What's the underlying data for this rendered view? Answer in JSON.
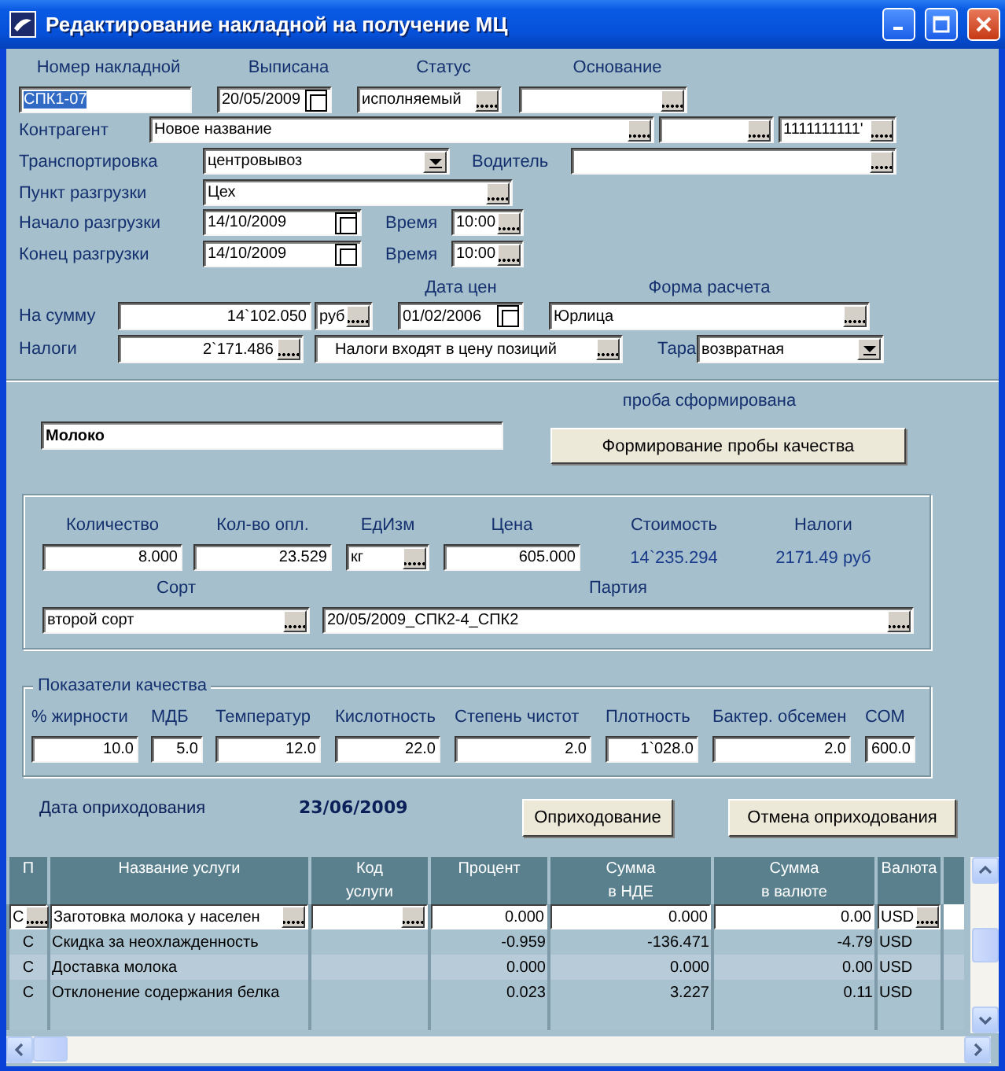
{
  "window": {
    "title": "Редактирование накладной на получение МЦ"
  },
  "header": {
    "number": {
      "label": "Номер накладной",
      "value": "СПК1-07",
      "focused": true
    },
    "issued": {
      "label": "Выписана",
      "value": "20/05/2009"
    },
    "status": {
      "label": "Статус",
      "value": "исполняемый"
    },
    "basis": {
      "label": "Основание"
    },
    "counterparty": {
      "label": "Контрагент",
      "value": "Новое название",
      "inn": "1111111111'"
    },
    "transport": {
      "label": "Транспортировка",
      "value": "центровывоз"
    },
    "driver": {
      "label": "Водитель"
    },
    "unload_point": {
      "label": "Пункт разгрузки",
      "value": "Цех"
    },
    "unload_start": {
      "label": "Начало разгрузки",
      "date": "14/10/2009",
      "time_label": "Время",
      "time": "10:00"
    },
    "unload_end": {
      "label": "Конец разгрузки",
      "date": "14/10/2009",
      "time_label": "Время",
      "time": "10:00"
    },
    "price_date": {
      "label": "Дата цен",
      "value": "01/02/2006"
    },
    "payment_form": {
      "label": "Форма расчета",
      "value": "Юрлица"
    },
    "amount": {
      "label": "На сумму",
      "value": "14`102.050",
      "currency": "руб"
    },
    "taxes": {
      "label": "Налоги",
      "value": "2`171.486",
      "mode": "Налоги входят в цену позиций"
    },
    "container": {
      "label": "Тара",
      "value": "возвратная"
    }
  },
  "product": {
    "status_note": "проба сформирована",
    "name": "Молоко",
    "quality_button": "Формирование пробы качества"
  },
  "pricing": {
    "items": [
      {
        "kind": "input",
        "label": "Количество",
        "value": "8.000"
      },
      {
        "kind": "input",
        "label": "Кол-во опл.",
        "value": "23.529"
      },
      {
        "kind": "lookup",
        "label": "ЕдИзм",
        "value": "кг"
      },
      {
        "kind": "input",
        "label": "Цена",
        "value": "605.000"
      },
      {
        "kind": "readout",
        "label": "Стоимость",
        "value": "14`235.294"
      },
      {
        "kind": "readout",
        "label": "Налоги",
        "value": "2171.49 руб"
      }
    ],
    "grade": {
      "label": "Сорт",
      "value": "второй сорт"
    },
    "batch": {
      "label": "Партия",
      "value": "20/05/2009_СПК2-4_СПК2"
    }
  },
  "quality": {
    "title": "Показатели качества",
    "indicators": [
      {
        "label": "% жирности",
        "value": "10.0"
      },
      {
        "label": "МДБ",
        "value": "5.0"
      },
      {
        "label": "Температур",
        "value": "12.0"
      },
      {
        "label": "Кислотность",
        "value": "22.0"
      },
      {
        "label": "Степень чистот",
        "value": "2.0"
      },
      {
        "label": "Плотность",
        "value": "1`028.0"
      },
      {
        "label": "Бактер. обсемен",
        "value": "2.0"
      },
      {
        "label": "СОМ",
        "value": "600.0"
      }
    ]
  },
  "posting": {
    "date_label": "Дата оприходования",
    "date": "23/06/2009",
    "buttons": [
      "Оприходование",
      "Отмена оприходования"
    ]
  },
  "services": {
    "columns": [
      "П",
      "Название услуги",
      "Код\nуслуги",
      "Процент",
      "Сумма\nв НДЕ",
      "Сумма\nв валюте",
      "Валюта"
    ],
    "rows": [
      {
        "selected": true,
        "type": "С",
        "name": "Заготовка молока у населен",
        "code": "",
        "percent": "0.000",
        "sum_base": "0.000",
        "sum_currency": "0.00",
        "currency": "USD"
      },
      {
        "selected": false,
        "type": "С",
        "name": "Скидка за неохлажденность",
        "code": "",
        "percent": "-0.959",
        "sum_base": "-136.471",
        "sum_currency": "-4.79",
        "currency": "USD"
      },
      {
        "selected": false,
        "type": "С",
        "name": "Доставка молока",
        "code": "",
        "percent": "0.000",
        "sum_base": "0.000",
        "sum_currency": "0.00",
        "currency": "USD"
      },
      {
        "selected": false,
        "type": "С",
        "name": "Отклонение содержания белка",
        "code": "",
        "percent": "0.023",
        "sum_base": "3.227",
        "sum_currency": "0.11",
        "currency": "USD"
      }
    ]
  }
}
